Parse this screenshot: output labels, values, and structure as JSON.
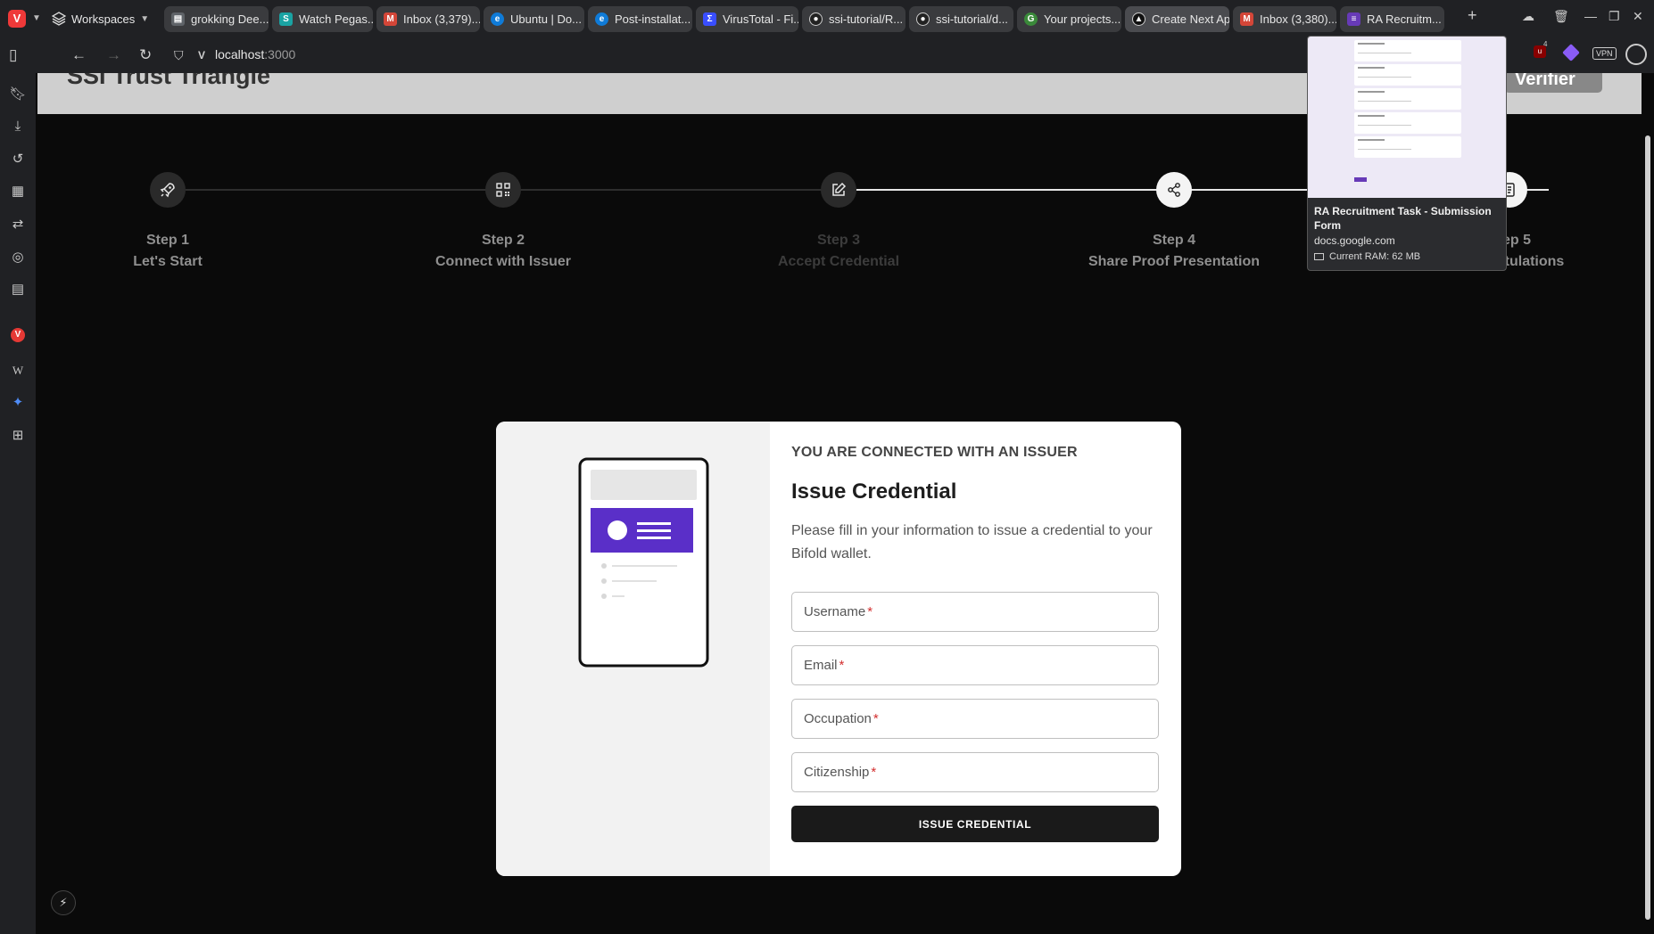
{
  "browser": {
    "workspaces_label": "Workspaces",
    "tabs": [
      {
        "title": "grokking Dee...",
        "favicon": "doc-icon",
        "color": "#5f6368"
      },
      {
        "title": "Watch Pegas...",
        "favicon": "s-icon",
        "color": "#1aa3a3"
      },
      {
        "title": "Inbox (3,379)...",
        "favicon": "gmail-icon",
        "color": "#d44638"
      },
      {
        "title": "Ubuntu | Do...",
        "favicon": "edge-icon",
        "color": "#0f7bd8"
      },
      {
        "title": "Post-installat...",
        "favicon": "edge-icon",
        "color": "#0f7bd8"
      },
      {
        "title": "VirusTotal - Fi...",
        "favicon": "virustotal-icon",
        "color": "#394eff"
      },
      {
        "title": "ssi-tutorial/R...",
        "favicon": "github-icon",
        "color": "#222222"
      },
      {
        "title": "ssi-tutorial/d...",
        "favicon": "github-icon",
        "color": "#222222"
      },
      {
        "title": "Your projects...",
        "favicon": "project-icon",
        "color": "#3a8a3a"
      },
      {
        "title": "Create Next Ap",
        "favicon": "vercel-icon",
        "color": "#111111"
      },
      {
        "title": "Inbox (3,380)...",
        "favicon": "gmail-icon",
        "color": "#d44638"
      },
      {
        "title": "RA Recruitm...",
        "favicon": "forms-icon",
        "color": "#673ab7"
      }
    ],
    "url_host": "localhost",
    "url_port": ":3000",
    "vpn_label": "VPN",
    "ublock_count": "4"
  },
  "tab_preview": {
    "title": "RA Recruitment Task - Submission Form",
    "url": "docs.google.com",
    "ram": "Current RAM: 62 MB"
  },
  "page": {
    "title": "SSI Trust Triangle",
    "verifier_button": "Verifier",
    "steps": [
      {
        "number": "Step 1",
        "name": "Let's Start",
        "icon": "rocket-icon"
      },
      {
        "number": "Step 2",
        "name": "Connect with Issuer",
        "icon": "qr-code-icon"
      },
      {
        "number": "Step 3",
        "name": "Accept Credential",
        "icon": "edit-icon"
      },
      {
        "number": "Step 4",
        "name": "Share Proof Presentation",
        "icon": "share-icon"
      },
      {
        "number": "Step 5",
        "name": "Congratulations",
        "icon": "document-icon"
      }
    ],
    "card": {
      "overline": "YOU ARE CONNECTED WITH AN ISSUER",
      "title": "Issue Credential",
      "description": "Please fill in your information to issue a credential to your Bifold wallet.",
      "fields": [
        {
          "label": "Username",
          "required": "*"
        },
        {
          "label": "Email",
          "required": "*"
        },
        {
          "label": "Occupation",
          "required": "*"
        },
        {
          "label": "Citizenship",
          "required": "*"
        }
      ],
      "submit_label": "ISSUE CREDENTIAL",
      "illustration_accent": "#5a2fc8"
    }
  }
}
